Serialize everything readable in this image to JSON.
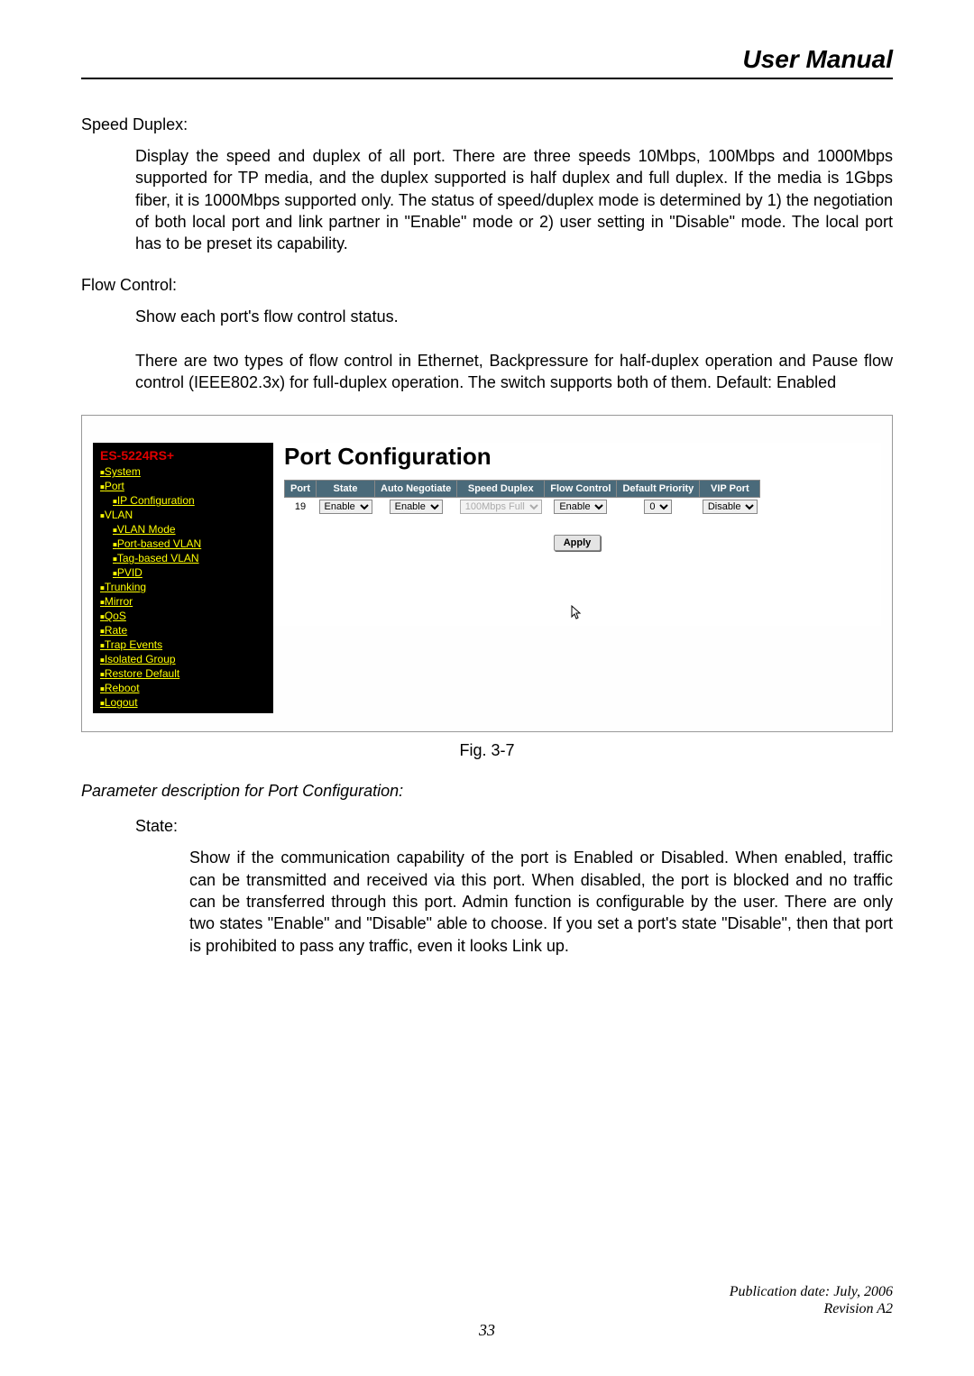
{
  "header": {
    "title": "User Manual"
  },
  "sections": {
    "speed_duplex": {
      "label": "Speed Duplex:",
      "body": "Display the speed and duplex of all port. There are three speeds 10Mbps, 100Mbps and 1000Mbps supported for TP media, and the duplex supported is half duplex and full duplex. If the media is 1Gbps fiber, it is 1000Mbps supported only. The status of speed/duplex mode is determined by 1) the negotiation of both local port and link partner in \"Enable\" mode or 2) user setting in \"Disable\" mode. The local port has to be preset its capability."
    },
    "flow_control": {
      "label": "Flow Control:",
      "body1": "Show each port's flow control status.",
      "body2": "There are two types of flow control in Ethernet, Backpressure for half-duplex operation and Pause flow control (IEEE802.3x) for full-duplex operation. The switch supports both of them. Default: Enabled"
    }
  },
  "screenshot": {
    "product_name": "ES-5224RS+",
    "nav": {
      "system": "System",
      "port": "Port",
      "ip_config": "IP Configuration",
      "vlan": "VLAN",
      "vlan_mode": "VLAN Mode",
      "port_based_vlan": "Port-based VLAN",
      "tag_based_vlan": "Tag-based VLAN",
      "pvid": "PVID",
      "trunking": "Trunking",
      "mirror": "Mirror",
      "qos": "QoS",
      "rate": "Rate",
      "trap_events": "Trap Events",
      "isolated_group": "Isolated Group",
      "restore_default": "Restore Default",
      "reboot": "Reboot",
      "logout": "Logout"
    },
    "content_title": "Port Configuration",
    "table": {
      "headers": {
        "port": "Port",
        "state": "State",
        "auto_negotiate": "Auto Negotiate",
        "speed_duplex": "Speed Duplex",
        "flow_control": "Flow Control",
        "default_priority": "Default Priority",
        "vip_port": "VIP Port"
      },
      "row": {
        "port": "19",
        "state": "Enable",
        "auto_negotiate": "Enable",
        "speed_duplex": "100Mbps Full",
        "flow_control": "Enable",
        "default_priority": "0",
        "vip_port": "Disable"
      }
    },
    "apply_label": "Apply"
  },
  "figure_caption": "Fig. 3-7",
  "param_section": {
    "title": "Parameter description for Port Configuration:",
    "state_label": "State:",
    "state_body": "Show if the communication capability of the port is Enabled or Disabled. When enabled, traffic can be transmitted and received via this port. When disabled, the port is blocked and no traffic can be transferred through this port. Admin function is configurable by the user. There are only two states \"Enable\" and \"Disable\" able to choose. If you set a port's state \"Disable\", then that port is prohibited to pass any traffic, even it looks Link up."
  },
  "footer": {
    "pub_date": "Publication date: July, 2006",
    "revision": "Revision A2",
    "page_num": "33"
  }
}
